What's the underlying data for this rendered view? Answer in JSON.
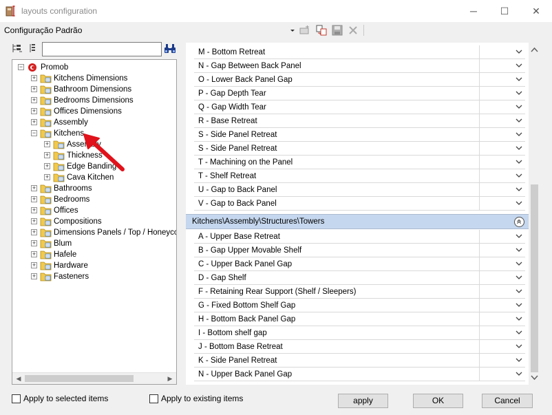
{
  "window": {
    "title": "layouts configuration",
    "minimize_glyph": "─",
    "maximize_glyph": "☐",
    "close_glyph": "✕"
  },
  "toolbar": {
    "config_label": "Configuração Padrão",
    "icons": [
      "dropdown-arrow-icon",
      "edit-icon",
      "copy-icon",
      "save-icon",
      "delete-icon"
    ]
  },
  "search": {
    "value": "",
    "placeholder": ""
  },
  "tree": {
    "items": [
      {
        "label": "Promob",
        "level": 0,
        "expanded": true,
        "icon": "promob-logo-icon"
      },
      {
        "label": "Kitchens Dimensions",
        "level": 1,
        "expanded": false
      },
      {
        "label": "Bathroom Dimensions",
        "level": 1,
        "expanded": false
      },
      {
        "label": "Bedrooms Dimensions",
        "level": 1,
        "expanded": false
      },
      {
        "label": "Offices Dimensions",
        "level": 1,
        "expanded": false
      },
      {
        "label": "Assembly",
        "level": 1,
        "expanded": false
      },
      {
        "label": "Kitchens",
        "level": 1,
        "expanded": true
      },
      {
        "label": "Assembly",
        "level": 2,
        "expanded": false
      },
      {
        "label": "Thickness",
        "level": 2,
        "expanded": false
      },
      {
        "label": "Edge Banding",
        "level": 2,
        "expanded": false
      },
      {
        "label": "Cava Kitchen",
        "level": 2,
        "expanded": false
      },
      {
        "label": "Bathrooms",
        "level": 1,
        "expanded": false
      },
      {
        "label": "Bedrooms",
        "level": 1,
        "expanded": false
      },
      {
        "label": "Offices",
        "level": 1,
        "expanded": false
      },
      {
        "label": "Compositions",
        "level": 1,
        "expanded": false
      },
      {
        "label": "Dimensions Panels / Top / Honeycomb",
        "level": 1,
        "expanded": false
      },
      {
        "label": "Blum",
        "level": 1,
        "expanded": false
      },
      {
        "label": "Hafele",
        "level": 1,
        "expanded": false
      },
      {
        "label": "Hardware",
        "level": 1,
        "expanded": false
      },
      {
        "label": "Fasteners",
        "level": 1,
        "expanded": false
      }
    ]
  },
  "properties": {
    "group1_rows": [
      "M - Bottom Retreat",
      "N - Gap Between Back Panel",
      "O - Lower Back Panel Gap",
      "P - Gap Depth Tear",
      "Q - Gap Width Tear",
      "R - Base Retreat",
      "S - Side Panel Retreat",
      "S - Side Panel Retreat",
      "T - Machining on the Panel",
      "T - Shelf Retreat",
      "U - Gap to Back Panel",
      "V - Gap to Back Panel"
    ],
    "group2_title": "Kitchens\\Assembly\\Structures\\Towers",
    "group2_rows": [
      "A - Upper Base Retreat",
      "B - Gap Upper Movable Shelf",
      "C - Upper Back Panel Gap",
      "D - Gap Shelf",
      "F - Retaining Rear Support (Shelf / Sleepers)",
      "G - Fixed Bottom Shelf Gap",
      "H - Bottom Back Panel Gap",
      "I - Bottom shelf gap",
      "J - Bottom Base Retreat",
      "K - Side Panel Retreat",
      "N - Upper Back Panel Gap"
    ]
  },
  "footer": {
    "apply_selected_label": "Apply to selected items",
    "apply_existing_label": "Apply to existing items",
    "apply_button": "apply",
    "ok_button": "OK",
    "cancel_button": "Cancel"
  },
  "colors": {
    "accent_group": "#c5d7ee",
    "folder": "#f2c94c",
    "arrow": "#e0121b"
  }
}
